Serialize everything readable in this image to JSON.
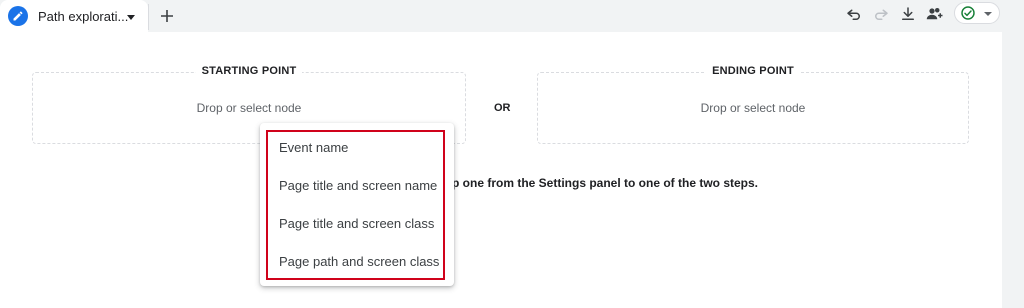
{
  "tab": {
    "label": "Path explorati...",
    "icon": "pencil-icon",
    "add_icon": "plus-icon"
  },
  "toolbar": {
    "icons": [
      "undo-icon",
      "redo-icon",
      "download-icon",
      "share-icon",
      "check-circle-icon"
    ]
  },
  "canvas": {
    "starting_point": {
      "title": "STARTING POINT",
      "hint": "Drop or select node"
    },
    "ending_point": {
      "title": "ENDING POINT",
      "hint": "Drop or select node"
    },
    "or_label": "OR",
    "instruction": "p one from the Settings panel to one of the two steps."
  },
  "menu": {
    "items": [
      "Event name",
      "Page title and screen name",
      "Page title and screen class",
      "Page path and screen class"
    ]
  },
  "colors": {
    "accent": "#1a73e8",
    "highlight": "#d0021b",
    "success": "#188038"
  }
}
